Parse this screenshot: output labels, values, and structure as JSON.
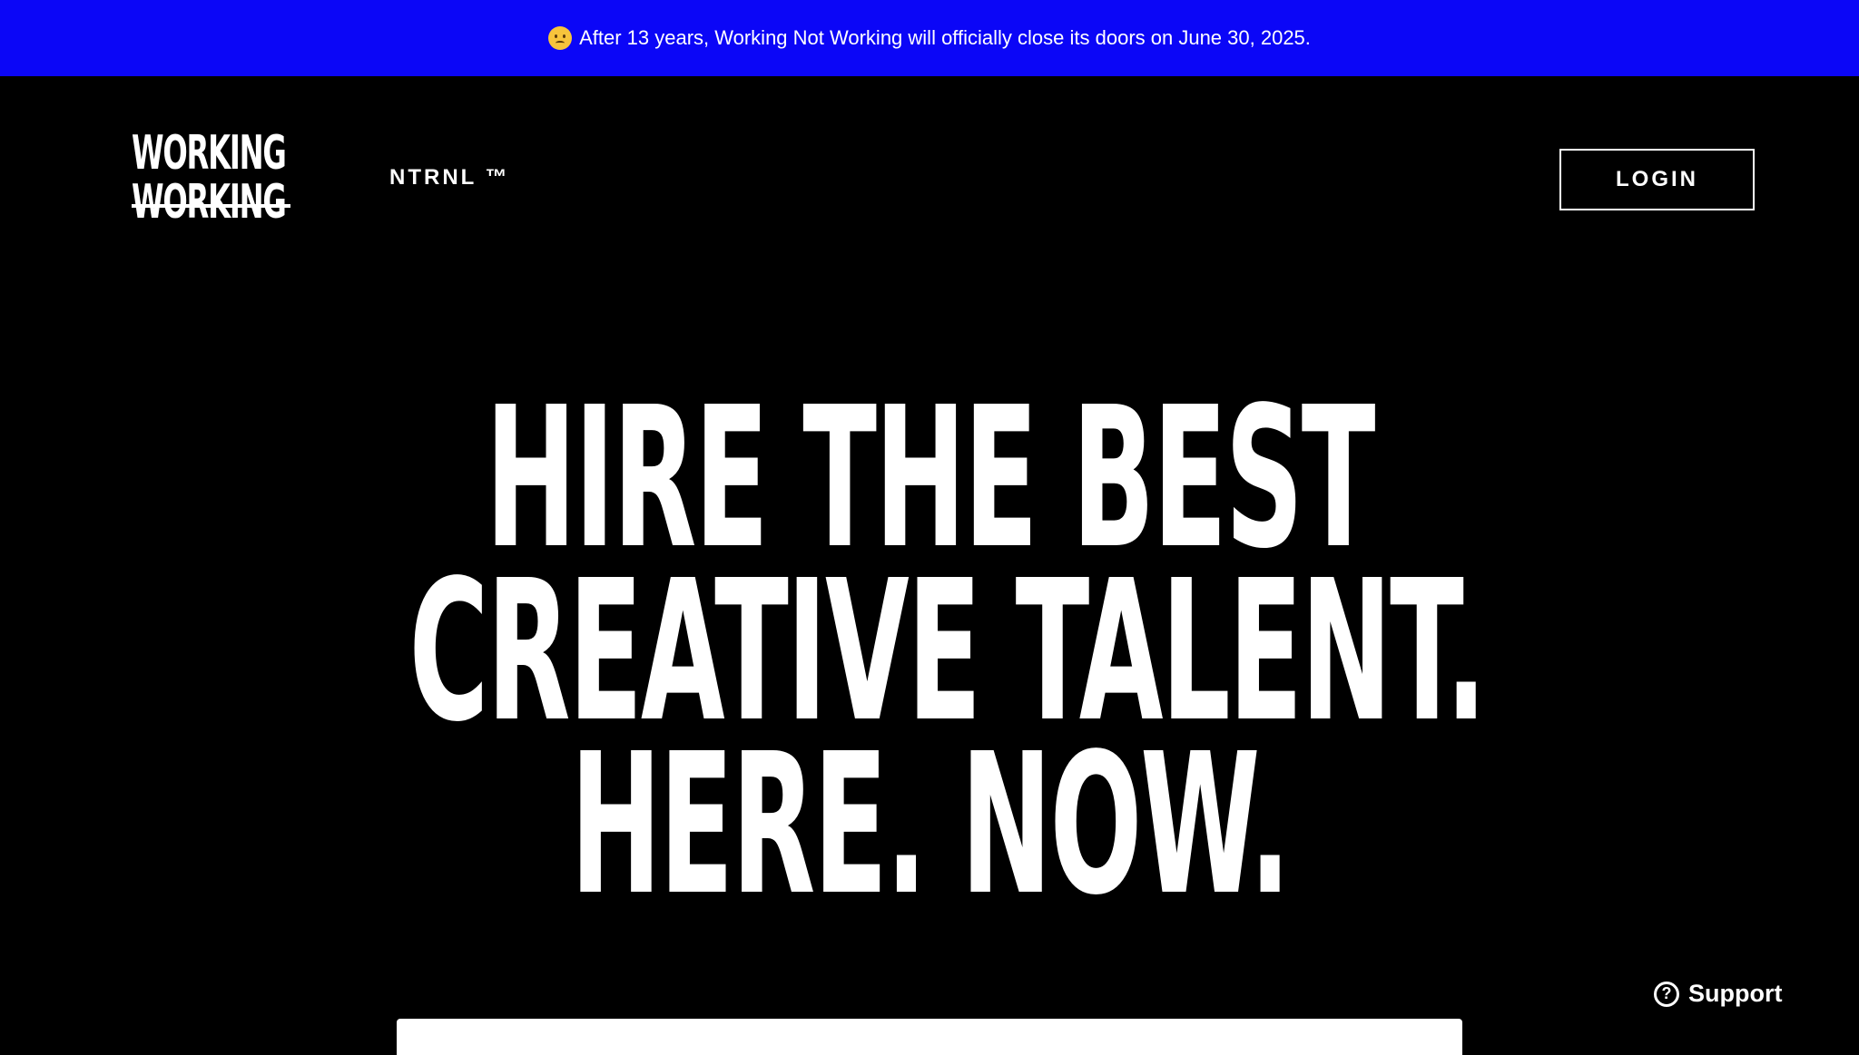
{
  "banner": {
    "emoji": "sad-face-icon",
    "text": "After 13 years, Working Not Working will officially close its doors on June 30, 2025.",
    "background": "#0b06f7"
  },
  "header": {
    "logo_top": "WORKING",
    "logo_bottom": "WORKING",
    "nav_link": "NTRNL ™",
    "login_label": "LOGIN"
  },
  "hero": {
    "line1": "HIRE THE BEST",
    "line2": "CREATIVE TALENT.",
    "line3": "HERE. NOW."
  },
  "support": {
    "icon": "question-circle-icon",
    "label": "Support"
  }
}
